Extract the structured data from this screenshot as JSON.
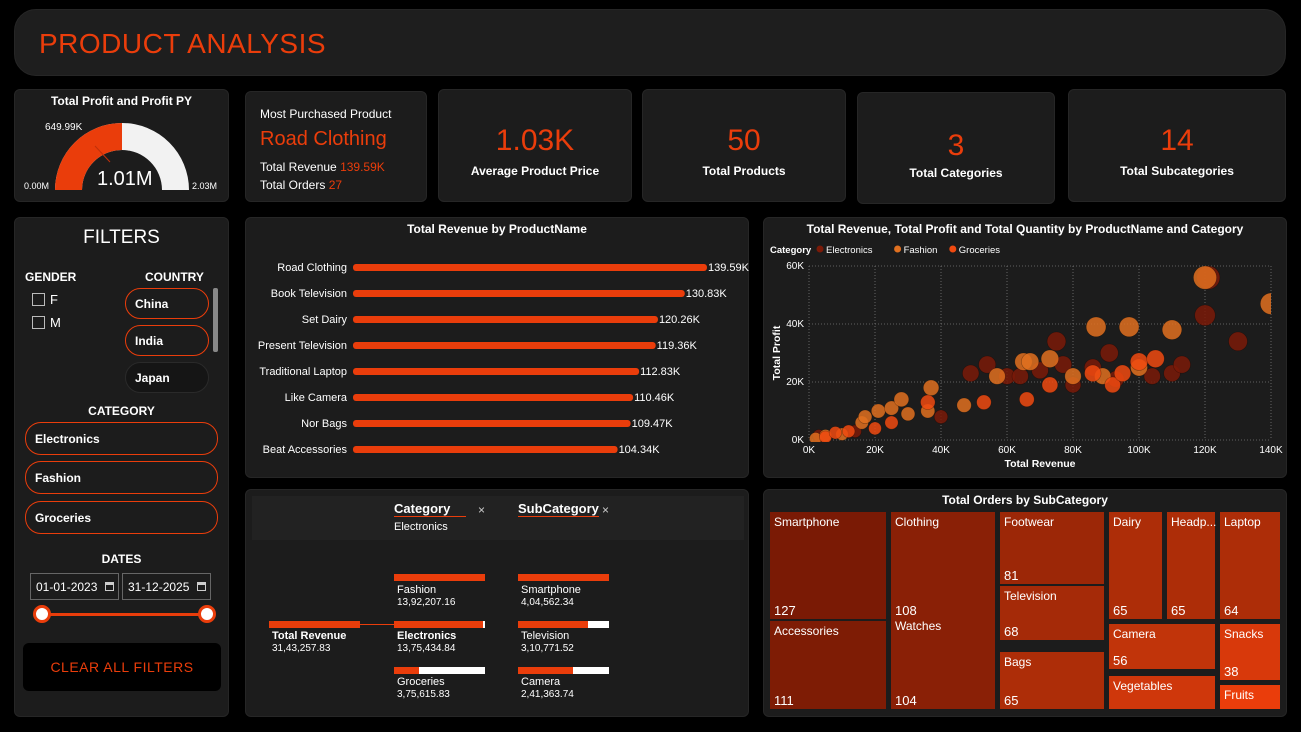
{
  "header": {
    "title": "PRODUCT ANALYSIS"
  },
  "gauge": {
    "title": "Total Profit and Profit PY",
    "value": "1.01M",
    "target": "649.99K",
    "min": "0.00M",
    "max": "2.03M",
    "fill_fraction": 0.5
  },
  "most_purchased": {
    "label": "Most Purchased Product",
    "product": "Road Clothing",
    "revenue_label": "Total Revenue ",
    "revenue": "139.59K",
    "orders_label": "Total Orders ",
    "orders": "27"
  },
  "kpis": [
    {
      "value": "1.03K",
      "label": "Average Product Price"
    },
    {
      "value": "50",
      "label": "Total Products"
    },
    {
      "value": "3",
      "label": "Total Categories"
    },
    {
      "value": "14",
      "label": "Total Subcategories"
    }
  ],
  "filters": {
    "title": "FILTERS",
    "gender_label": "GENDER",
    "gender": [
      "F",
      "M"
    ],
    "country_label": "COUNTRY",
    "countries": [
      "China",
      "India",
      "Japan"
    ],
    "category_label": "CATEGORY",
    "categories": [
      "Electronics",
      "Fashion",
      "Groceries"
    ],
    "dates_label": "DATES",
    "date_start": "01-01-2023",
    "date_end": "31-12-2025",
    "clear_button": "CLEAR ALL FILTERS"
  },
  "bar_chart": {
    "title": "Total Revenue by ProductName"
  },
  "scatter": {
    "title": "Total Revenue, Total Profit and Total Quantity by ProductName and Category",
    "legend_title": "Category",
    "x_ticks": [
      "0K",
      "20K",
      "40K",
      "60K",
      "80K",
      "100K",
      "120K",
      "140K"
    ],
    "y_ticks": [
      "0K",
      "20K",
      "40K",
      "60K"
    ]
  },
  "decomp": {
    "category_header": "Category",
    "category_sub": "Electronics",
    "subcategory_header": "SubCategory",
    "close": "×",
    "root": {
      "name": "Total Revenue",
      "value": "31,43,257.83"
    },
    "level1": [
      {
        "name": "Fashion",
        "value": "13,92,207.16",
        "fill": 1.0
      },
      {
        "name": "Electronics",
        "value": "13,75,434.84",
        "fill": 0.98
      },
      {
        "name": "Groceries",
        "value": "3,75,615.83",
        "fill": 0.27
      }
    ],
    "level2": [
      {
        "name": "Smartphone",
        "value": "4,04,562.34",
        "fill": 1.0
      },
      {
        "name": "Television",
        "value": "3,10,771.52",
        "fill": 0.77
      },
      {
        "name": "Camera",
        "value": "2,41,363.74",
        "fill": 0.6
      }
    ]
  },
  "treemap": {
    "title": "Total Orders by SubCategory"
  },
  "chart_data": [
    {
      "type": "bar",
      "title": "Total Revenue by ProductName",
      "categories": [
        "Road Clothing",
        "Book Television",
        "Set Dairy",
        "Present Television",
        "Traditional Laptop",
        "Like Camera",
        "Nor Bags",
        "Beat Accessories"
      ],
      "values": [
        139.59,
        130.83,
        120.26,
        119.36,
        112.83,
        110.46,
        109.47,
        104.34
      ],
      "labels": [
        "139.59K",
        "130.83K",
        "120.26K",
        "119.36K",
        "112.83K",
        "110.46K",
        "109.47K",
        "104.34K"
      ],
      "color": "#ea3d0b"
    },
    {
      "type": "scatter",
      "title": "Total Revenue, Total Profit and Total Quantity by ProductName and Category",
      "xlabel": "Total Revenue",
      "ylabel": "Total Profit",
      "xlim": [
        0,
        140000
      ],
      "ylim": [
        0,
        60000
      ],
      "grid": true,
      "legend_position": "top-left",
      "series": [
        {
          "name": "Electronics",
          "color": "#7a1a08",
          "points": [
            [
              3000,
              1500
            ],
            [
              14000,
              3000
            ],
            [
              40000,
              8000
            ],
            [
              49000,
              23000
            ],
            [
              54000,
              26000
            ],
            [
              60000,
              22000
            ],
            [
              64000,
              22000
            ],
            [
              70000,
              24000
            ],
            [
              75000,
              34000
            ],
            [
              77000,
              26000
            ],
            [
              80000,
              19000
            ],
            [
              86000,
              25000
            ],
            [
              91000,
              30000
            ],
            [
              93000,
              21000
            ],
            [
              104000,
              22000
            ],
            [
              110000,
              23000
            ],
            [
              113000,
              26000
            ],
            [
              120000,
              43000
            ],
            [
              121000,
              56000
            ],
            [
              130000,
              34000
            ]
          ]
        },
        {
          "name": "Fashion",
          "color": "#e07020",
          "points": [
            [
              2000,
              500
            ],
            [
              5000,
              1500
            ],
            [
              10000,
              2000
            ],
            [
              16000,
              6000
            ],
            [
              17000,
              8000
            ],
            [
              21000,
              10000
            ],
            [
              25000,
              11000
            ],
            [
              28000,
              14000
            ],
            [
              30000,
              9000
            ],
            [
              36000,
              10000
            ],
            [
              37000,
              18000
            ],
            [
              47000,
              12000
            ],
            [
              57000,
              22000
            ],
            [
              65000,
              27000
            ],
            [
              67000,
              27000
            ],
            [
              73000,
              28000
            ],
            [
              80000,
              22000
            ],
            [
              87000,
              39000
            ],
            [
              89000,
              22000
            ],
            [
              97000,
              39000
            ],
            [
              100000,
              25000
            ],
            [
              110000,
              38000
            ],
            [
              120000,
              56000
            ],
            [
              140000,
              47000
            ]
          ]
        },
        {
          "name": "Groceries",
          "color": "#f04a10",
          "points": [
            [
              5000,
              1000
            ],
            [
              8000,
              2500
            ],
            [
              12000,
              3000
            ],
            [
              20000,
              4000
            ],
            [
              25000,
              6000
            ],
            [
              36000,
              13000
            ],
            [
              53000,
              13000
            ],
            [
              66000,
              14000
            ],
            [
              73000,
              19000
            ],
            [
              86000,
              23000
            ],
            [
              92000,
              19000
            ],
            [
              95000,
              23000
            ],
            [
              100000,
              27000
            ],
            [
              105000,
              28000
            ]
          ]
        }
      ]
    },
    {
      "type": "treemap",
      "title": "Total Orders by SubCategory",
      "categories": [
        "Smartphone",
        "Clothing",
        "Footwear",
        "Dairy",
        "Headp...",
        "Laptop",
        "Accessories",
        "Watches",
        "Television",
        "Camera",
        "Snacks",
        "Bags",
        "Vegetables",
        "Fruits"
      ],
      "values": [
        127,
        108,
        81,
        65,
        65,
        64,
        111,
        104,
        68,
        56,
        38,
        65,
        null,
        null
      ]
    }
  ]
}
